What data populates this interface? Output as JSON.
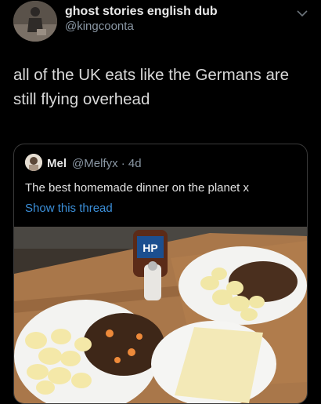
{
  "author": {
    "name": "ghost stories english dub",
    "handle": "@kingcoonta"
  },
  "tweet": {
    "text": "all of the UK eats like the Germans are still flying overhead"
  },
  "quoted": {
    "name": "Mel",
    "handle": "@Melfyx · 4d",
    "text": "The best homemade dinner on the planet x",
    "link": "Show this thread",
    "bottle_label": "HP"
  },
  "colors": {
    "background": "#000000",
    "link": "#3b8fd9",
    "handle": "#8b98a5"
  }
}
